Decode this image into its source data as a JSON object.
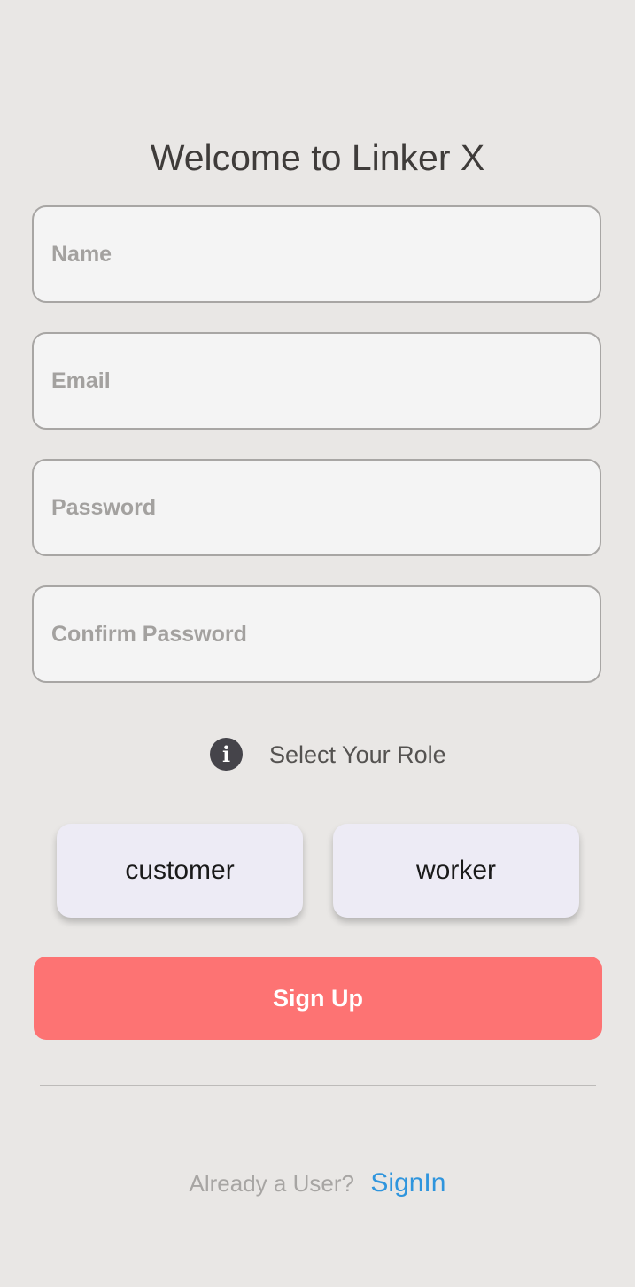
{
  "header": {
    "title": "Welcome to Linker X"
  },
  "form": {
    "name_placeholder": "Name",
    "email_placeholder": "Email",
    "password_placeholder": "Password",
    "confirm_password_placeholder": "Confirm Password"
  },
  "role": {
    "icon": "info-icon",
    "label": "Select Your Role",
    "options": [
      "customer",
      "worker"
    ]
  },
  "actions": {
    "signup_label": "Sign Up",
    "signup_color": "#fd7373"
  },
  "footer": {
    "prompt": "Already a User?",
    "signin_label": "SignIn",
    "signin_color": "#2f95dd"
  }
}
